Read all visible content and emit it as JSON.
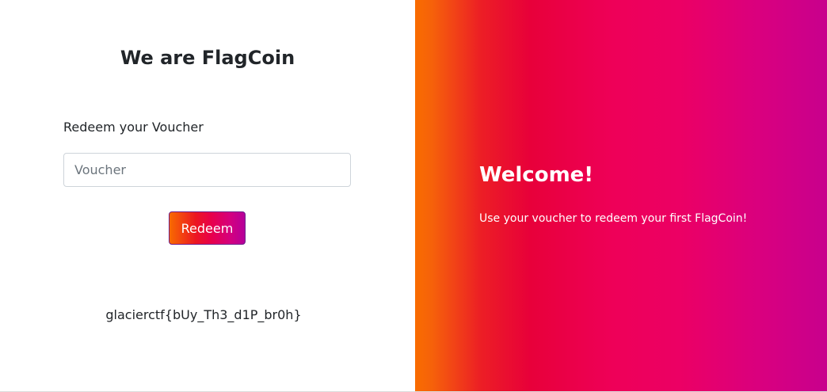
{
  "login": {
    "title": "We are FlagCoin",
    "redeem_label": "Redeem your Voucher",
    "voucher_placeholder": "Voucher",
    "voucher_value": "",
    "redeem_button": "Redeem",
    "flag_text": "glacierctf{bUy_Th3_d1P_br0h}"
  },
  "welcome_panel": {
    "heading": "Welcome!",
    "text": "Use your voucher to redeem your first FlagCoin!"
  },
  "colors": {
    "gradient_start": "#f96c00",
    "gradient_mid": "#e8003a",
    "gradient_end": "#c8008d",
    "text_dark": "#212529"
  }
}
